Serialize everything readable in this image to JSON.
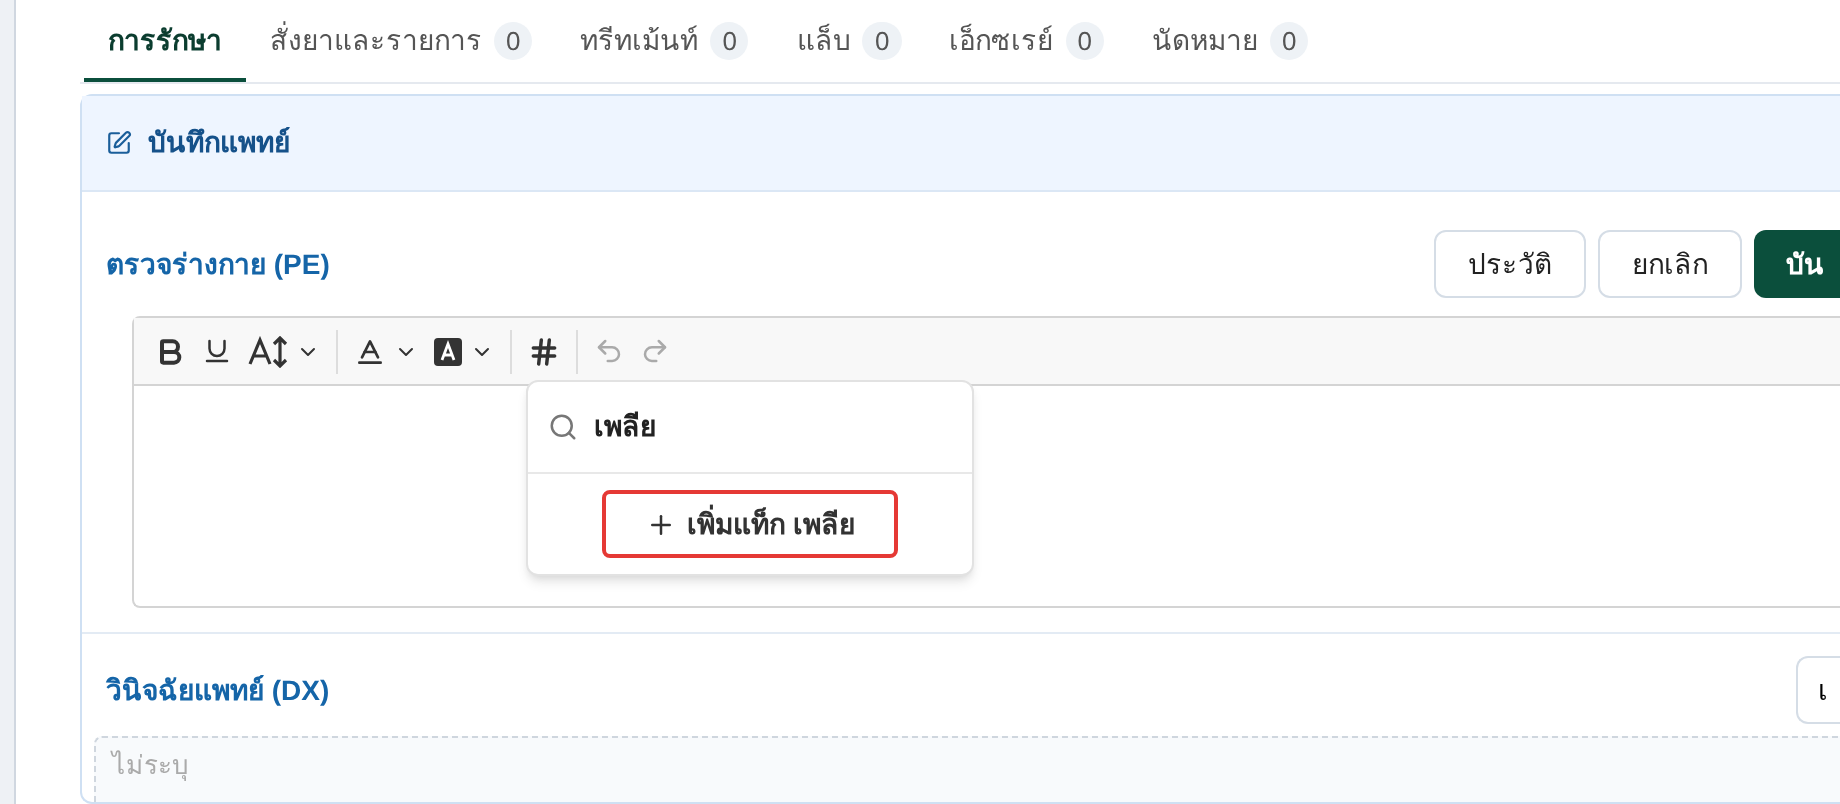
{
  "tabs": [
    {
      "label": "การรักษา",
      "selected": true
    },
    {
      "label": "สั่งยาและรายการ",
      "count": "0",
      "selected": false
    },
    {
      "label": "ทรีทเม้นท์",
      "count": "0",
      "selected": false
    },
    {
      "label": "แล็บ",
      "count": "0",
      "selected": false
    },
    {
      "label": "เอ็กซเรย์",
      "count": "0",
      "selected": false
    },
    {
      "label": "นัดหมาย",
      "count": "0",
      "selected": false
    }
  ],
  "card": {
    "title": "บันทึกแพทย์"
  },
  "pe": {
    "title": "ตรวจร่างกาย (PE)",
    "buttons": [
      {
        "label": "ประวัติ",
        "kind": "outline"
      },
      {
        "label": "ยกเลิก",
        "kind": "outline"
      },
      {
        "label": "บัน",
        "kind": "primary"
      }
    ],
    "tag_search": {
      "value": "เพลีย",
      "add_button": "เพิ่มแท็ก เพลีย",
      "highlighted": true
    }
  },
  "dx": {
    "title": "วินิจฉัยแพทย์ (DX)",
    "button": "เ",
    "placeholder": "ไม่ระบุ"
  }
}
